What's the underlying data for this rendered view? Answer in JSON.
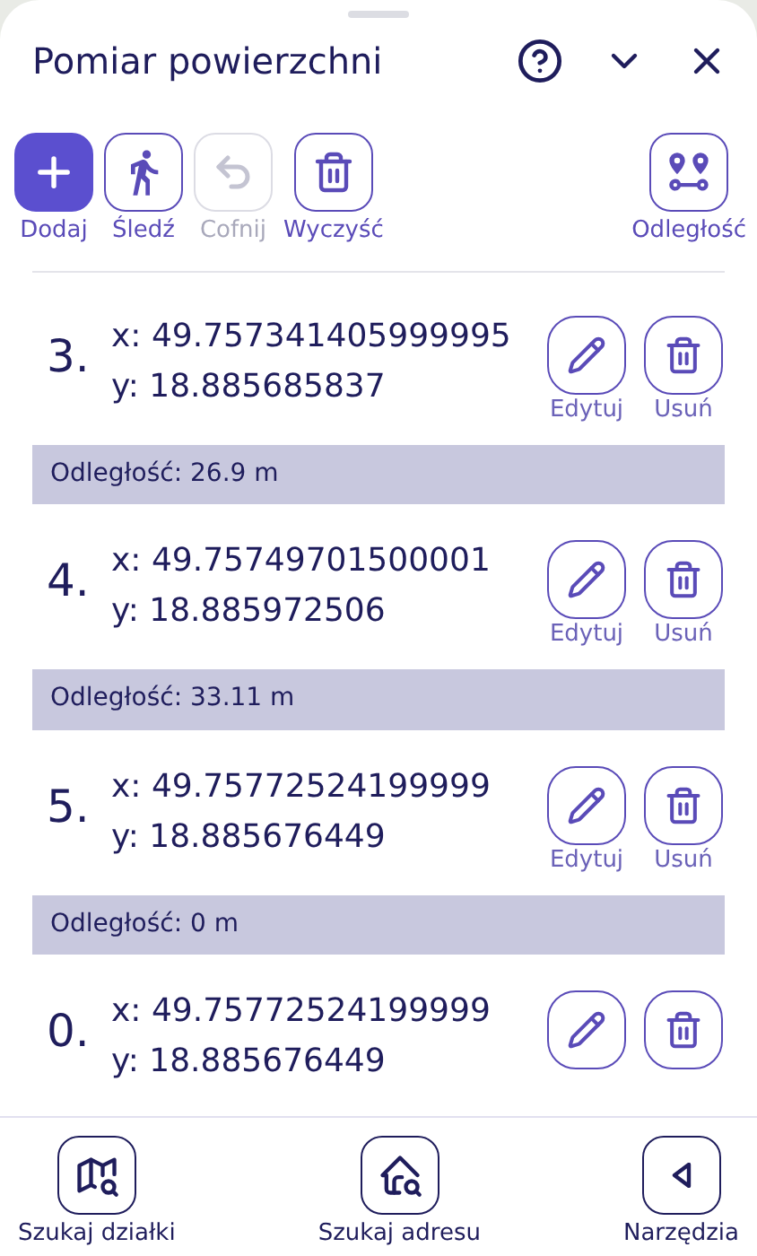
{
  "title": "Pomiar powierzchni",
  "toolbar": [
    {
      "kind": "add",
      "label": "Dodaj",
      "primary": true,
      "disabled": false
    },
    {
      "kind": "track",
      "label": "Śledź",
      "primary": false,
      "disabled": false
    },
    {
      "kind": "undo",
      "label": "Cofnij",
      "primary": false,
      "disabled": true
    },
    {
      "kind": "clear",
      "label": "Wyczyść",
      "primary": false,
      "disabled": false
    },
    {
      "kind": "distance",
      "label": "Odległość",
      "primary": false,
      "disabled": false
    }
  ],
  "list": [
    {
      "kind": "point",
      "number": "3.",
      "x": "x: 49.757341405999995",
      "y": "y: 18.885685837",
      "edit_label": "Edytuj",
      "delete_label": "Usuń"
    },
    {
      "kind": "distance",
      "text": "Odległość: 26.9 m"
    },
    {
      "kind": "point",
      "number": "4.",
      "x": "x: 49.75749701500001",
      "y": "y: 18.885972506",
      "edit_label": "Edytuj",
      "delete_label": "Usuń"
    },
    {
      "kind": "distance",
      "text": "Odległość: 33.11 m"
    },
    {
      "kind": "point",
      "number": "5.",
      "x": "x: 49.75772524199999",
      "y": "y: 18.885676449",
      "edit_label": "Edytuj",
      "delete_label": "Usuń"
    },
    {
      "kind": "distance",
      "text": "Odległość: 0 m"
    },
    {
      "kind": "point",
      "number": "0.",
      "x": "x: 49.75772524199999",
      "y": "y: 18.885676449"
    }
  ],
  "nav": [
    {
      "kind": "parcel",
      "label": "Szukaj działki"
    },
    {
      "kind": "address",
      "label": "Szukaj adresu"
    },
    {
      "kind": "back",
      "label": "Narzędzia"
    }
  ]
}
